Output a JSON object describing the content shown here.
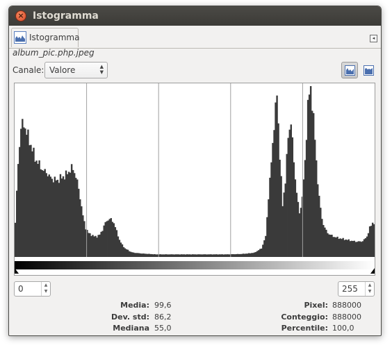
{
  "window": {
    "title": "Istogramma"
  },
  "tab": {
    "label": "Istogramma"
  },
  "image_name": "album_pic.php.jpeg",
  "channel": {
    "label": "Canale:",
    "value": "Valore"
  },
  "range": {
    "low": "0",
    "high": "255"
  },
  "stats_left": [
    {
      "label": "Media:",
      "value": "99,6"
    },
    {
      "label": "Dev. std:",
      "value": "86,2"
    },
    {
      "label": "Mediana",
      "value": "55,0"
    }
  ],
  "stats_right": [
    {
      "label": "Pixel:",
      "value": "888000"
    },
    {
      "label": "Conteggio:",
      "value": "888000"
    },
    {
      "label": "Percentile:",
      "value": "100,0"
    }
  ],
  "colors": {
    "bars": "#3a3a3a",
    "grid": "#a0a0a0",
    "accent": "#4a6fae"
  },
  "chart_data": {
    "type": "bar",
    "x": [
      0,
      255
    ],
    "peak": 1,
    "profile": [
      [
        0,
        0.2
      ],
      [
        2,
        0.55
      ],
      [
        4,
        0.76
      ],
      [
        6,
        0.78
      ],
      [
        8,
        0.73
      ],
      [
        10,
        0.68
      ],
      [
        12,
        0.63
      ],
      [
        14,
        0.58
      ],
      [
        16,
        0.55
      ],
      [
        18,
        0.53
      ],
      [
        20,
        0.5
      ],
      [
        22,
        0.5
      ],
      [
        24,
        0.47
      ],
      [
        26,
        0.46
      ],
      [
        28,
        0.45
      ],
      [
        30,
        0.45
      ],
      [
        32,
        0.46
      ],
      [
        34,
        0.47
      ],
      [
        36,
        0.48
      ],
      [
        38,
        0.5
      ],
      [
        40,
        0.52
      ],
      [
        42,
        0.5
      ],
      [
        44,
        0.44
      ],
      [
        46,
        0.35
      ],
      [
        48,
        0.24
      ],
      [
        50,
        0.17
      ],
      [
        52,
        0.14
      ],
      [
        54,
        0.13
      ],
      [
        56,
        0.12
      ],
      [
        58,
        0.12
      ],
      [
        60,
        0.13
      ],
      [
        62,
        0.16
      ],
      [
        64,
        0.2
      ],
      [
        66,
        0.22
      ],
      [
        68,
        0.22
      ],
      [
        70,
        0.2
      ],
      [
        72,
        0.15
      ],
      [
        74,
        0.1
      ],
      [
        76,
        0.07
      ],
      [
        78,
        0.05
      ],
      [
        80,
        0.04
      ],
      [
        82,
        0.03
      ],
      [
        84,
        0.025
      ],
      [
        90,
        0.02
      ],
      [
        100,
        0.015
      ],
      [
        140,
        0.015
      ],
      [
        150,
        0.015
      ],
      [
        160,
        0.017
      ],
      [
        165,
        0.02
      ],
      [
        170,
        0.025
      ],
      [
        175,
        0.05
      ],
      [
        178,
        0.12
      ],
      [
        180,
        0.35
      ],
      [
        182,
        0.55
      ],
      [
        184,
        0.78
      ],
      [
        186,
        0.95
      ],
      [
        188,
        0.6
      ],
      [
        190,
        0.3
      ],
      [
        192,
        0.45
      ],
      [
        194,
        0.7
      ],
      [
        196,
        0.8
      ],
      [
        198,
        0.55
      ],
      [
        200,
        0.38
      ],
      [
        202,
        0.25
      ],
      [
        204,
        0.35
      ],
      [
        206,
        0.55
      ],
      [
        208,
        0.9
      ],
      [
        210,
        1.0
      ],
      [
        212,
        0.82
      ],
      [
        214,
        0.55
      ],
      [
        216,
        0.35
      ],
      [
        218,
        0.22
      ],
      [
        220,
        0.17
      ],
      [
        222,
        0.14
      ],
      [
        226,
        0.12
      ],
      [
        230,
        0.11
      ],
      [
        236,
        0.1
      ],
      [
        242,
        0.09
      ],
      [
        246,
        0.09
      ],
      [
        248,
        0.1
      ],
      [
        250,
        0.12
      ],
      [
        252,
        0.17
      ],
      [
        254,
        0.2
      ],
      [
        255,
        0.2
      ]
    ]
  }
}
